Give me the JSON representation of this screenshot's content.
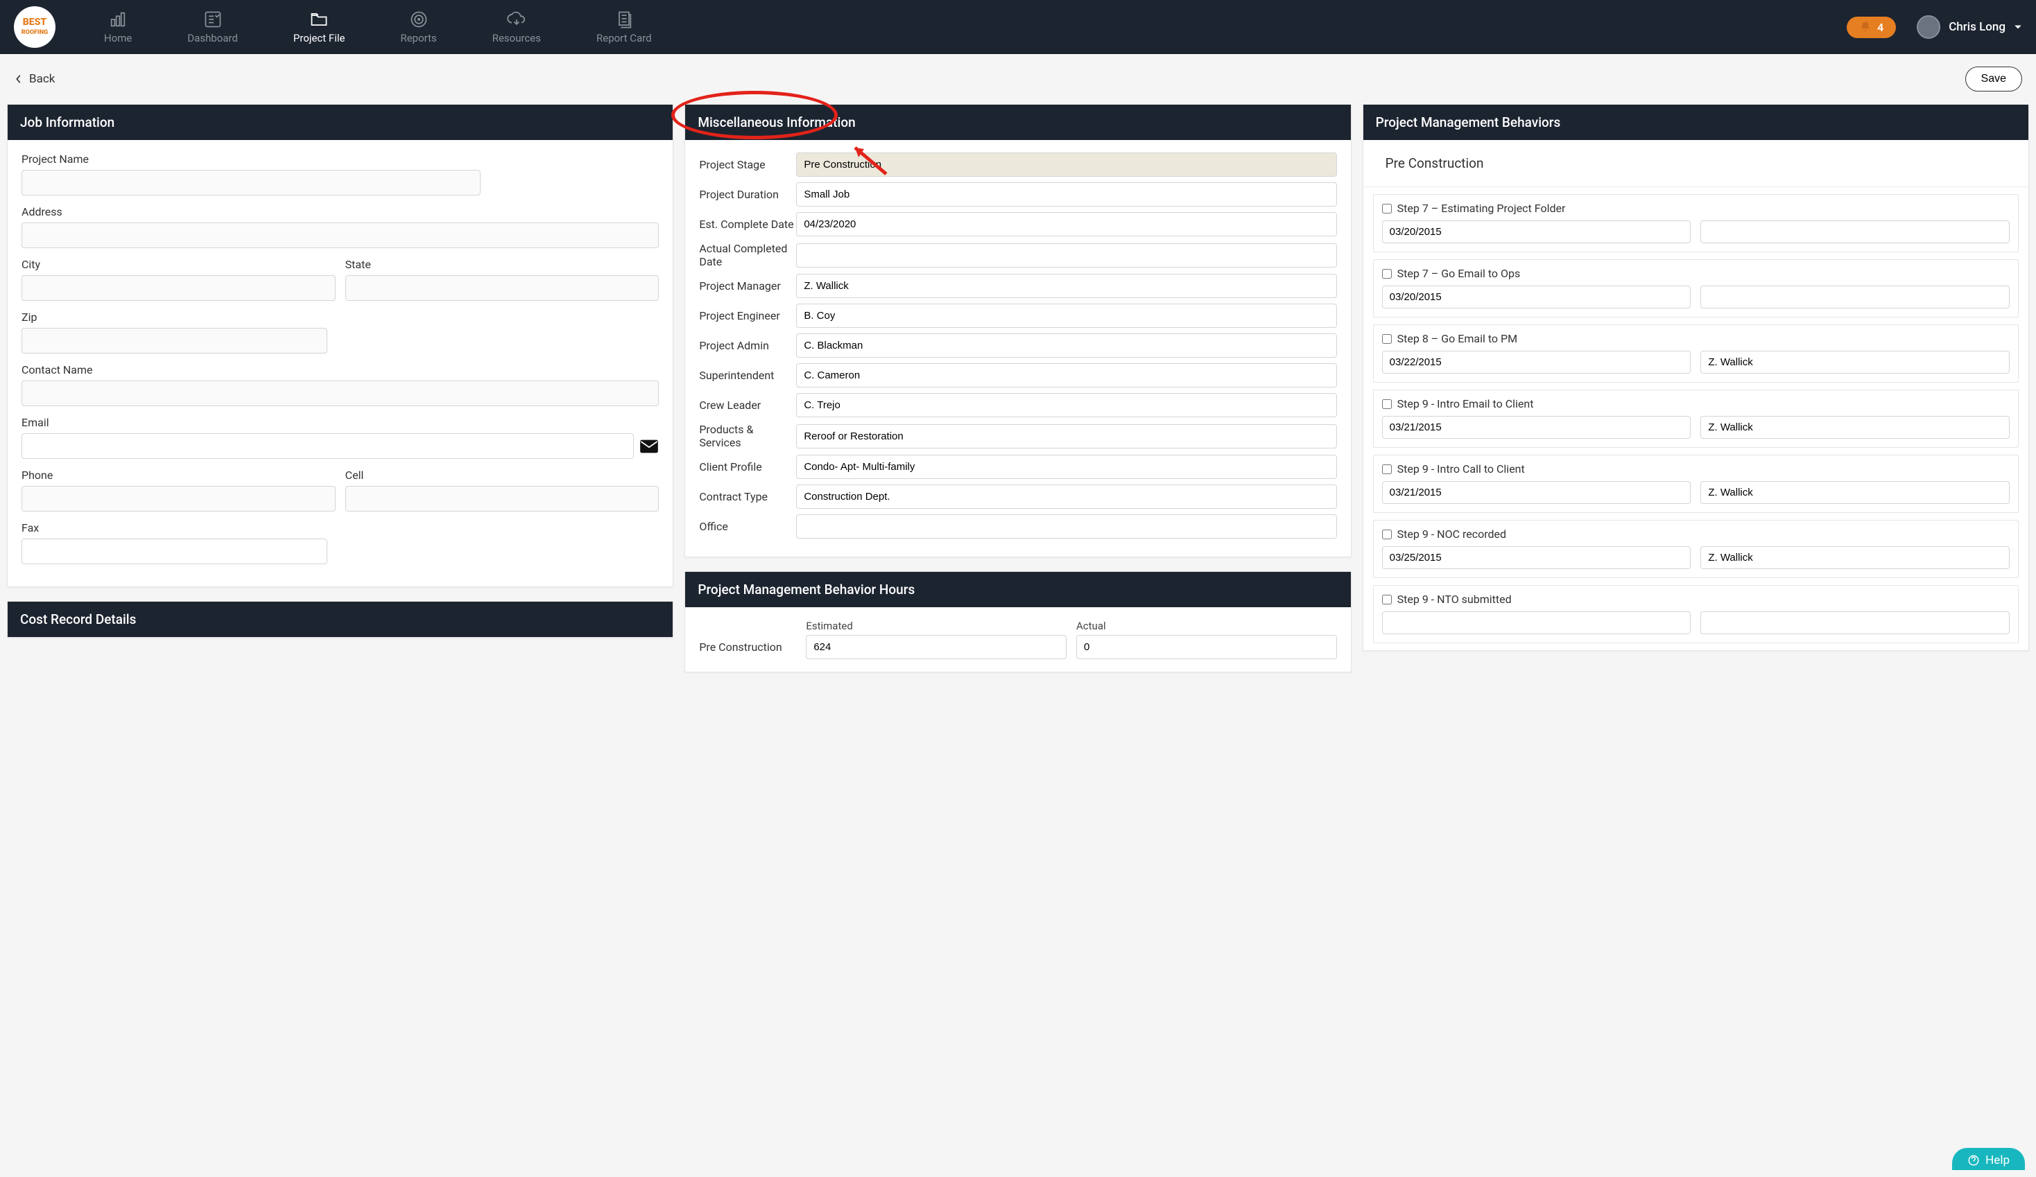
{
  "nav": {
    "items": [
      {
        "label": "Home"
      },
      {
        "label": "Dashboard"
      },
      {
        "label": "Project File"
      },
      {
        "label": "Reports"
      },
      {
        "label": "Resources"
      },
      {
        "label": "Report Card"
      }
    ],
    "notif_count": "4",
    "user_name": "Chris Long"
  },
  "actions": {
    "back": "Back",
    "save": "Save"
  },
  "job_info": {
    "title": "Job Information",
    "labels": {
      "project_name": "Project Name",
      "address": "Address",
      "city": "City",
      "state": "State",
      "zip": "Zip",
      "contact_name": "Contact Name",
      "email": "Email",
      "phone": "Phone",
      "cell": "Cell",
      "fax": "Fax"
    },
    "values": {
      "project_name": "",
      "address": "",
      "city": "",
      "state": "",
      "zip": "",
      "contact_name": "",
      "email": "",
      "phone": "",
      "cell": "",
      "fax": ""
    }
  },
  "cost_record": {
    "title": "Cost Record Details"
  },
  "misc": {
    "title": "Miscellaneous Information",
    "rows": {
      "project_stage": {
        "label": "Project Stage",
        "value": "Pre Construction"
      },
      "project_duration": {
        "label": "Project Duration",
        "value": "Small Job"
      },
      "est_complete": {
        "label": "Est. Complete Date",
        "value": "04/23/2020"
      },
      "actual_complete": {
        "label": "Actual Completed Date",
        "value": ""
      },
      "project_manager": {
        "label": "Project Manager",
        "value": "Z. Wallick"
      },
      "project_engineer": {
        "label": "Project Engineer",
        "value": "B. Coy"
      },
      "project_admin": {
        "label": "Project Admin",
        "value": "C. Blackman"
      },
      "superintendent": {
        "label": "Superintendent",
        "value": "C. Cameron"
      },
      "crew_leader": {
        "label": "Crew Leader",
        "value": "C. Trejo"
      },
      "products": {
        "label": "Products & Services",
        "value": "Reroof or Restoration"
      },
      "client_profile": {
        "label": "Client Profile",
        "value": "Condo- Apt- Multi-family"
      },
      "contract_type": {
        "label": "Contract Type",
        "value": "Construction Dept."
      },
      "office": {
        "label": "Office",
        "value": ""
      }
    }
  },
  "pmbh": {
    "title": "Project Management Behavior Hours",
    "headers": {
      "est": "Estimated",
      "act": "Actual"
    },
    "row1": {
      "label": "Pre Construction",
      "est": "624",
      "act": "0"
    }
  },
  "behaviors": {
    "title": "Project Management Behaviors",
    "stage": "Pre Construction",
    "steps": [
      {
        "label": "Step 7 – Estimating Project Folder",
        "date": "03/20/2015",
        "who": ""
      },
      {
        "label": "Step 7 – Go Email to Ops",
        "date": "03/20/2015",
        "who": ""
      },
      {
        "label": "Step 8 – Go Email to PM",
        "date": "03/22/2015",
        "who": "Z. Wallick"
      },
      {
        "label": "Step 9 - Intro Email to Client",
        "date": "03/21/2015",
        "who": "Z. Wallick"
      },
      {
        "label": "Step 9 - Intro Call to Client",
        "date": "03/21/2015",
        "who": "Z. Wallick"
      },
      {
        "label": "Step 9 - NOC recorded",
        "date": "03/25/2015",
        "who": "Z. Wallick"
      },
      {
        "label": "Step 9 - NTO submitted",
        "date": "",
        "who": ""
      }
    ]
  },
  "help": "Help"
}
